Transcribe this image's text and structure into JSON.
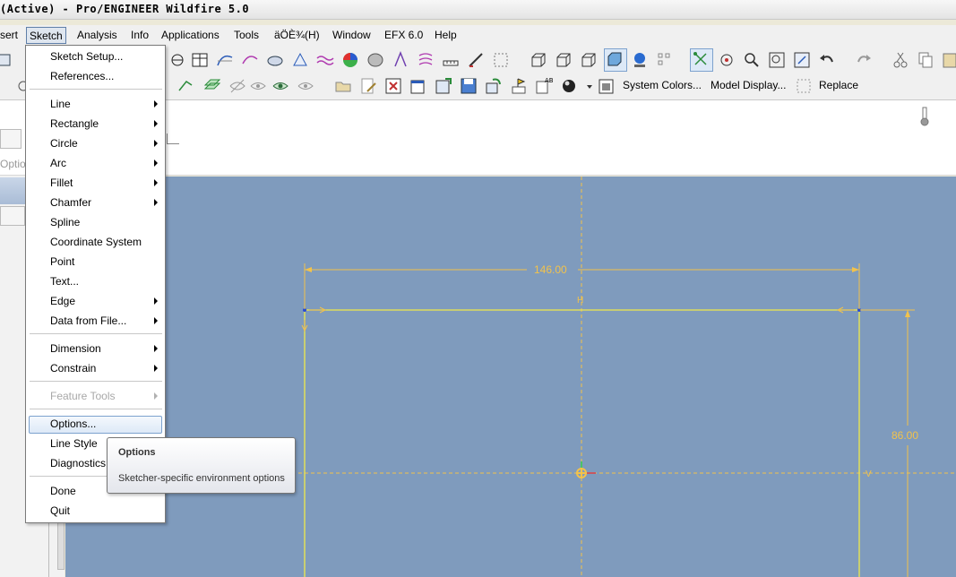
{
  "window": {
    "title": "(Active) - Pro/ENGINEER Wildfire 5.0"
  },
  "menubar": {
    "items": [
      {
        "label": "sert"
      },
      {
        "label": "Sketch"
      },
      {
        "label": "Analysis"
      },
      {
        "label": "Info"
      },
      {
        "label": "Applications"
      },
      {
        "label": "Tools"
      },
      {
        "label": "äÖÈ¾(H)"
      },
      {
        "label": "Window"
      },
      {
        "label": "EFX 6.0"
      },
      {
        "label": "Help"
      }
    ]
  },
  "toolbar": {
    "system_colors": "System Colors...",
    "model_display": "Model Display...",
    "replace": "Replace"
  },
  "left_panel": {
    "options_label": "Optio"
  },
  "sketch_menu": {
    "items": [
      {
        "label": "Sketch Setup...",
        "submenu": false,
        "disabled": false
      },
      {
        "label": "References...",
        "submenu": false,
        "disabled": false
      },
      {
        "label": "Line",
        "submenu": true,
        "disabled": false
      },
      {
        "label": "Rectangle",
        "submenu": true,
        "disabled": false
      },
      {
        "label": "Circle",
        "submenu": true,
        "disabled": false
      },
      {
        "label": "Arc",
        "submenu": true,
        "disabled": false
      },
      {
        "label": "Fillet",
        "submenu": true,
        "disabled": false
      },
      {
        "label": "Chamfer",
        "submenu": true,
        "disabled": false
      },
      {
        "label": "Spline",
        "submenu": false,
        "disabled": false
      },
      {
        "label": "Coordinate System",
        "submenu": false,
        "disabled": false
      },
      {
        "label": "Point",
        "submenu": false,
        "disabled": false
      },
      {
        "label": "Text...",
        "submenu": false,
        "disabled": false
      },
      {
        "label": "Edge",
        "submenu": true,
        "disabled": false
      },
      {
        "label": "Data from File...",
        "submenu": true,
        "disabled": false
      },
      {
        "label": "Dimension",
        "submenu": true,
        "disabled": false
      },
      {
        "label": "Constrain",
        "submenu": true,
        "disabled": false
      },
      {
        "label": "Feature Tools",
        "submenu": true,
        "disabled": true
      },
      {
        "label": "Options...",
        "submenu": false,
        "disabled": false,
        "highlighted": true
      },
      {
        "label": "Line Style",
        "submenu": false,
        "disabled": false
      },
      {
        "label": "Diagnostics",
        "submenu": false,
        "disabled": false
      },
      {
        "label": "Done",
        "submenu": false,
        "disabled": false
      },
      {
        "label": "Quit",
        "submenu": false,
        "disabled": false
      }
    ]
  },
  "tooltip": {
    "title": "Options",
    "description": "Sketcher-specific environment options"
  },
  "sketch": {
    "width_dim": "146.00",
    "height_dim": "86.00",
    "h_label": "H",
    "v_label": "V",
    "colors": {
      "background": "#7f9bbd",
      "geometry": "#f0e94a",
      "dimension": "#f2c24b",
      "centerline": "#f2c24b"
    }
  }
}
